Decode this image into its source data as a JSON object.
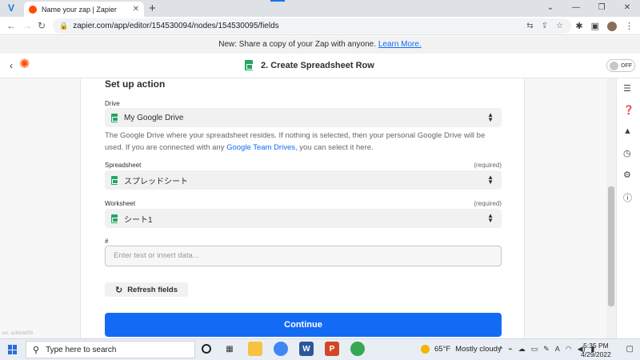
{
  "browser": {
    "tab_title": "Name your zap | Zapier",
    "new_tab": "+",
    "url": "zapier.com/app/editor/154530094/nodes/154530095/fields"
  },
  "banner": {
    "text": "New: Share a copy of your Zap with anyone.",
    "link": "Learn More."
  },
  "header": {
    "step_title": "2. Create Spreadsheet Row",
    "toggle_label": "OFF"
  },
  "form": {
    "section_title": "Set up action",
    "drive_label": "Drive",
    "drive_value": "My Google Drive",
    "help_text_1": "The Google Drive where your spreadsheet resides. If nothing is selected, then your personal Google Drive will be used. If you are connected with any ",
    "help_link": "Google Team Drives",
    "help_text_2": ", you can select it here.",
    "spreadsheet_label": "Spreadsheet",
    "spreadsheet_required": "(required)",
    "spreadsheet_value": "スプレッドシート",
    "worksheet_label": "Worksheet",
    "worksheet_required": "(required)",
    "worksheet_value": "シート1",
    "hash_label": "#",
    "hash_placeholder": "Enter text or insert data...",
    "refresh_label": "Refresh fields",
    "continue_label": "Continue",
    "version": "ver. ac6ddaf05"
  },
  "taskbar": {
    "search_placeholder": "Type here to search",
    "weather_temp": "65°F",
    "weather_desc": "Mostly cloudy",
    "time": "5:35 PM",
    "date": "4/29/2022"
  }
}
